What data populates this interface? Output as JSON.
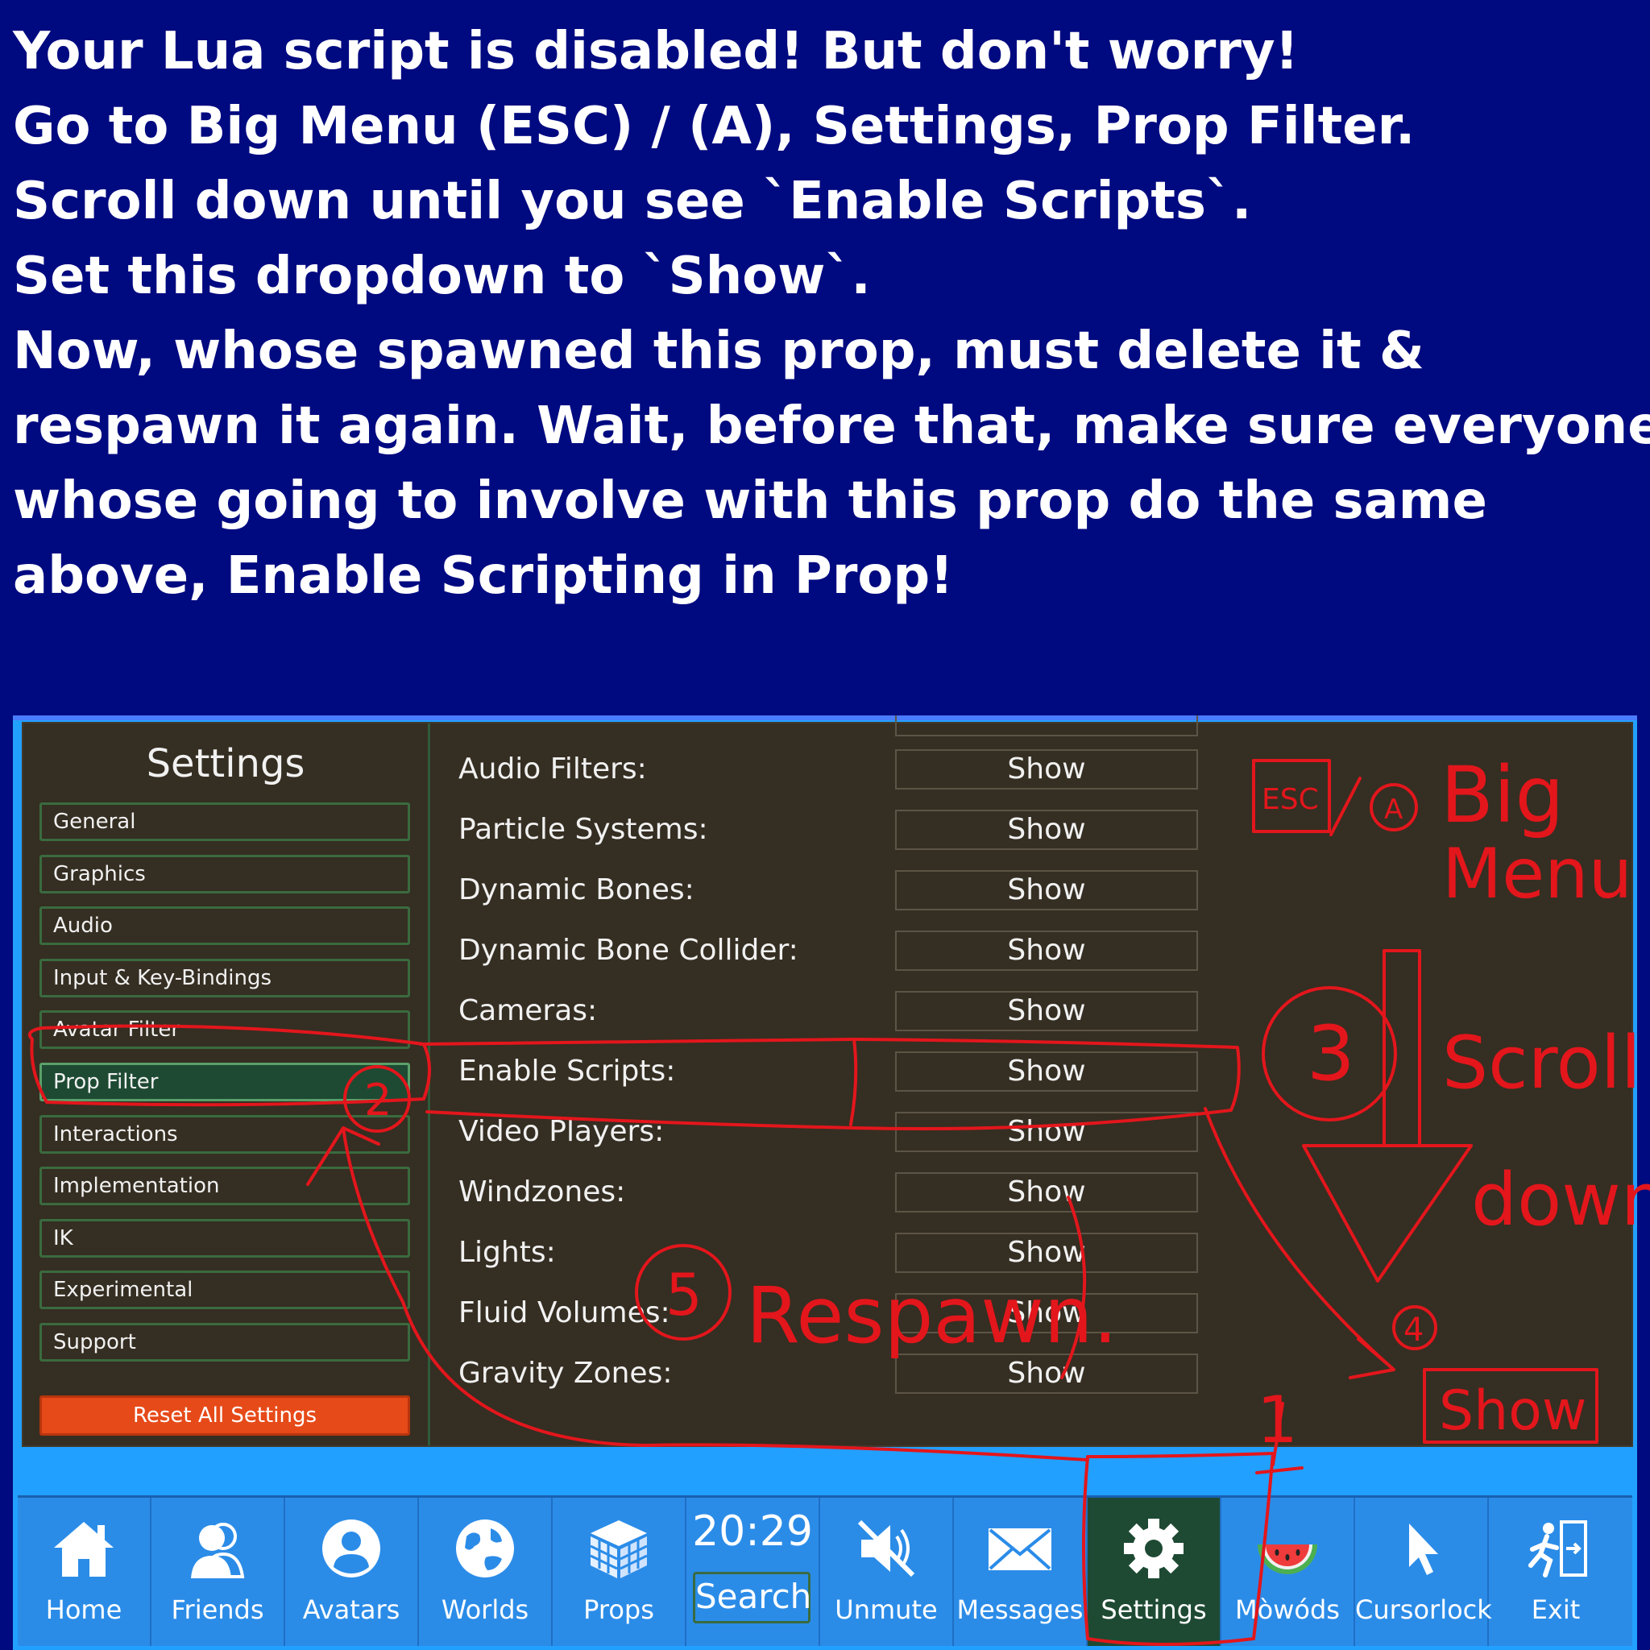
{
  "instructions": [
    "Your Lua script is disabled! But don't worry!",
    "Go to Big Menu (ESC) / (A), Settings, Prop Filter.",
    "Scroll down until you see `Enable Scripts`.",
    "Set this dropdown to `Show`.",
    "Now, whose spawned this prop, must delete it &",
    "respawn it again. Wait, before that, make sure everyone",
    "whose going to involve with this prop do the same",
    "above, Enable Scripting in Prop!"
  ],
  "settings": {
    "title": "Settings",
    "categories": [
      "General",
      "Graphics",
      "Audio",
      "Input & Key-Bindings",
      "Avatar Filter",
      "Prop Filter",
      "Interactions",
      "Implementation",
      "IK",
      "Experimental",
      "Support"
    ],
    "active_category": "Prop Filter",
    "reset_label": "Reset All Settings",
    "rows": [
      {
        "label": "Audio Filters:",
        "value": "Show"
      },
      {
        "label": "Particle Systems:",
        "value": "Show"
      },
      {
        "label": "Dynamic Bones:",
        "value": "Show"
      },
      {
        "label": "Dynamic Bone Collider:",
        "value": "Show"
      },
      {
        "label": "Cameras:",
        "value": "Show"
      },
      {
        "label": "Enable Scripts:",
        "value": "Show"
      },
      {
        "label": "Video Players:",
        "value": "Show"
      },
      {
        "label": "Windzones:",
        "value": "Show"
      },
      {
        "label": "Lights:",
        "value": "Show"
      },
      {
        "label": "Fluid Volumes:",
        "value": "Show"
      },
      {
        "label": "Gravity Zones:",
        "value": "Show"
      }
    ]
  },
  "menu": {
    "home": "Home",
    "friends": "Friends",
    "avatars": "Avatars",
    "worlds": "Worlds",
    "props": "Props",
    "clock": "20:29",
    "search": "Search",
    "unmute": "Unmute",
    "messages": "Messages",
    "settings": "Settings",
    "mowods": "Mòwóds",
    "cursorlock": "Cursorlock",
    "exit": "Exit"
  },
  "annotations": {
    "esc": "ESC",
    "a": "A",
    "big": "Big",
    "menu": "Menu",
    "step1": "1",
    "step2": "2",
    "step3": "3",
    "step4": "4",
    "step5": "5",
    "scroll": "Scroll",
    "down": "down",
    "show": "Show",
    "respawn": "Respawn.",
    "color": "#e3161c"
  },
  "colors": {
    "background": "#000a80",
    "panel": "#352e22",
    "menubar": "#2b8ce8",
    "accent_green": "#1e4a33",
    "reset": "#e64a19"
  }
}
